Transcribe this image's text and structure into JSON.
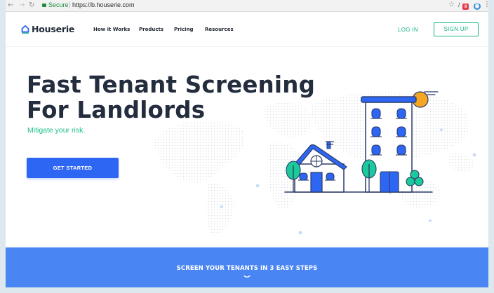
{
  "browser": {
    "back_icon": "arrow-left-icon",
    "forward_icon": "arrow-right-icon",
    "reload_icon": "reload-icon",
    "secure_label": "Secure",
    "url": "https://b.houserie.com",
    "extension_badge": "8"
  },
  "header": {
    "brand": "Houserie",
    "nav": [
      "How it Works",
      "Products",
      "Pricing",
      "Resources"
    ],
    "login_label": "LOG IN",
    "signup_label": "SIGN UP"
  },
  "hero": {
    "title_line1": "Fast Tenant Screening",
    "title_line2": "For Landlords",
    "subtitle": "Mitigate your risk.",
    "cta_label": "GET STARTED"
  },
  "steps": {
    "title": "SCREEN YOUR TENANTS IN 3 EASY STEPS"
  },
  "colors": {
    "accent_green": "#1bb38a",
    "primary_blue": "#2e66f4",
    "band_blue": "#4a86f3",
    "title_dark": "#232d3e"
  }
}
